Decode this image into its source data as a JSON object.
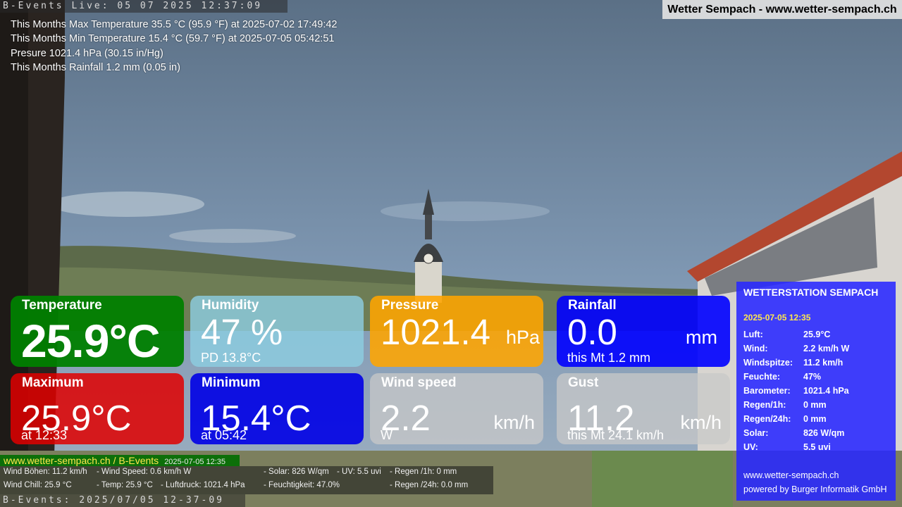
{
  "ticker_top": "B-Events Live: 05 07 2025 12:37:09",
  "ticker_bottom": "B-Events: 2025/07/05 12-37-09",
  "site_title": "Wetter Sempach - www.wetter-sempach.ch",
  "stats": [
    "This Months Max Temperature 35.5 °C (95.9 °F) at 2025-07-02 17:49:42",
    "This Months Min Temperature 15.4 °C (59.7 °F) at 2025-07-05 05:42:51",
    "Presure 1021.4 hPa (30.15 in/Hg)",
    "This Months Rainfall 1.2 mm (0.05 in)"
  ],
  "tiles": {
    "temperature": {
      "label": "Temperature",
      "value": "25.9°C"
    },
    "humidity": {
      "label": "Humidity",
      "value": "47 %",
      "sub": "PD 13.8°C"
    },
    "pressure": {
      "label": "Pressure",
      "value": "1021.4",
      "unit": "hPa"
    },
    "rainfall": {
      "label": "Rainfall",
      "value": "0.0",
      "unit": "mm",
      "sub": "this Mt 1.2 mm"
    },
    "maximum": {
      "label": "Maximum",
      "value": "25.9°C",
      "sub": "at 12:33"
    },
    "minimum": {
      "label": "Minimum",
      "value": "15.4°C",
      "sub": "at 05:42"
    },
    "wind": {
      "label": "Wind speed",
      "value": "2.2",
      "unit": "km/h",
      "sub": "W"
    },
    "gust": {
      "label": "Gust",
      "value": "11.2",
      "unit": "km/h",
      "sub": "this Mt 24.1 km/h"
    }
  },
  "station": {
    "title": "WETTERSTATION SEMPACH",
    "date": "2025-07-05 12:35",
    "rows": [
      {
        "k": "Luft:",
        "v": "25.9°C"
      },
      {
        "k": "Wind:",
        "v": "2.2 km/h  W"
      },
      {
        "k": "Windspitze:",
        "v": "11.2 km/h"
      },
      {
        "k": "Feuchte:",
        "v": "47%"
      },
      {
        "k": "Barometer:",
        "v": "1021.4 hPa"
      },
      {
        "k": "Regen/1h:",
        "v": "0 mm"
      },
      {
        "k": "Regen/24h:",
        "v": "0 mm"
      },
      {
        "k": "Solar:",
        "v": "826 W/qm"
      },
      {
        "k": "UV:",
        "v": "5.5 uvi"
      }
    ],
    "url": "www.wetter-sempach.ch",
    "powered": "powered by Burger Informatik GmbH"
  },
  "bottom": {
    "link": "www.wetter-sempach.ch / B-Events",
    "date": "2025-07-05 12:35",
    "line1": {
      "wind_boehen": "Wind Böhen: 11.2 km/h",
      "wind_speed": "- Wind Speed: 0.6 km/h W",
      "solar": "- Solar: 826 W/qm",
      "uv": "- UV: 5.5 uvi",
      "regen1h": "- Regen /1h:   0 mm"
    },
    "line2": {
      "wind_chill": "Wind Chill: 25.9 °C",
      "temp": "- Temp: 25.9 °C",
      "luftdruck": "- Luftdruck: 1021.4 hPa",
      "feuchtigkeit": "- Feuchtigkeit: 47.0%",
      "regen24h": "- Regen /24h: 0.0 mm"
    }
  }
}
